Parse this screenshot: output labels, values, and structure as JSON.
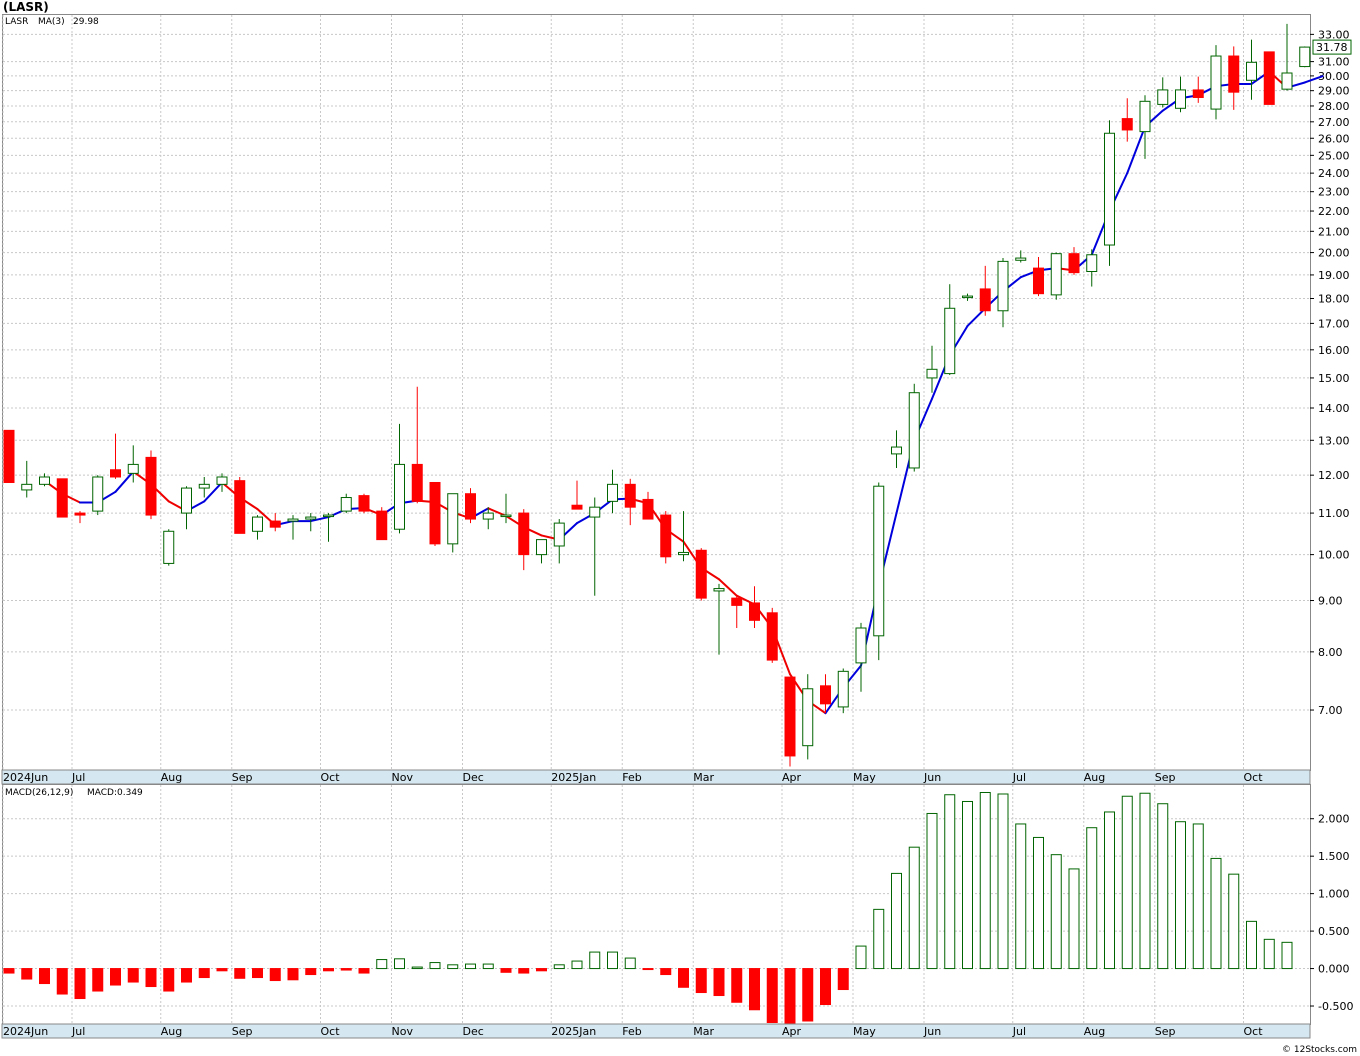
{
  "chart_data": {
    "type": "candlestick",
    "symbol_title": "(LASR)",
    "price_panel": {
      "legend": {
        "symbol": "LASR",
        "ma_label": "MA(3)",
        "ma_value": "29.98"
      },
      "last_price_label": "31.78",
      "y_scale": "log",
      "ylim": [
        6.1,
        34.5
      ],
      "y_ticks": [
        "7.00",
        "8.00",
        "9.00",
        "10.00",
        "11.00",
        "12.00",
        "13.00",
        "14.00",
        "15.00",
        "16.00",
        "17.00",
        "18.00",
        "19.00",
        "20.00",
        "21.00",
        "22.00",
        "23.00",
        "24.00",
        "25.00",
        "26.00",
        "27.00",
        "28.00",
        "29.00",
        "30.00",
        "31.00",
        "33.00"
      ],
      "candles": [
        {
          "o": 13.3,
          "h": 13.3,
          "l": 11.8,
          "c": 11.8
        },
        {
          "o": 11.6,
          "h": 12.4,
          "l": 11.4,
          "c": 11.75
        },
        {
          "o": 11.75,
          "h": 12.05,
          "l": 11.7,
          "c": 11.95
        },
        {
          "o": 11.9,
          "h": 11.9,
          "l": 10.9,
          "c": 10.9
        },
        {
          "o": 11.0,
          "h": 11.05,
          "l": 10.75,
          "c": 10.95
        },
        {
          "o": 11.05,
          "h": 12.0,
          "l": 10.95,
          "c": 11.95
        },
        {
          "o": 12.15,
          "h": 13.2,
          "l": 11.9,
          "c": 11.95
        },
        {
          "o": 12.05,
          "h": 12.85,
          "l": 11.8,
          "c": 12.3
        },
        {
          "o": 12.5,
          "h": 12.7,
          "l": 10.85,
          "c": 10.95
        },
        {
          "o": 9.8,
          "h": 10.6,
          "l": 9.75,
          "c": 10.55
        },
        {
          "o": 11.0,
          "h": 11.7,
          "l": 10.6,
          "c": 11.65
        },
        {
          "o": 11.65,
          "h": 11.95,
          "l": 11.4,
          "c": 11.75
        },
        {
          "o": 11.75,
          "h": 12.05,
          "l": 11.55,
          "c": 11.95
        },
        {
          "o": 11.85,
          "h": 11.95,
          "l": 10.5,
          "c": 10.5
        },
        {
          "o": 10.55,
          "h": 10.95,
          "l": 10.35,
          "c": 10.9
        },
        {
          "o": 10.8,
          "h": 11.0,
          "l": 10.55,
          "c": 10.65
        },
        {
          "o": 10.8,
          "h": 10.95,
          "l": 10.35,
          "c": 10.85
        },
        {
          "o": 10.85,
          "h": 11.0,
          "l": 10.55,
          "c": 10.9
        },
        {
          "o": 10.95,
          "h": 11.0,
          "l": 10.3,
          "c": 10.95
        },
        {
          "o": 11.05,
          "h": 11.5,
          "l": 11.0,
          "c": 11.4
        },
        {
          "o": 11.45,
          "h": 11.5,
          "l": 11.0,
          "c": 11.05
        },
        {
          "o": 11.05,
          "h": 11.15,
          "l": 10.35,
          "c": 10.35
        },
        {
          "o": 10.6,
          "h": 13.5,
          "l": 10.5,
          "c": 12.3
        },
        {
          "o": 12.3,
          "h": 14.7,
          "l": 11.25,
          "c": 11.3
        },
        {
          "o": 11.8,
          "h": 11.8,
          "l": 10.2,
          "c": 10.25
        },
        {
          "o": 10.25,
          "h": 11.5,
          "l": 10.05,
          "c": 11.5
        },
        {
          "o": 11.5,
          "h": 11.65,
          "l": 10.75,
          "c": 10.85
        },
        {
          "o": 10.85,
          "h": 11.15,
          "l": 10.6,
          "c": 11.0
        },
        {
          "o": 10.95,
          "h": 11.5,
          "l": 10.75,
          "c": 10.95
        },
        {
          "o": 11.0,
          "h": 11.1,
          "l": 9.65,
          "c": 10.0
        },
        {
          "o": 10.0,
          "h": 10.35,
          "l": 9.8,
          "c": 10.35
        },
        {
          "o": 10.2,
          "h": 10.85,
          "l": 9.8,
          "c": 10.75
        },
        {
          "o": 11.2,
          "h": 11.85,
          "l": 11.1,
          "c": 11.1
        },
        {
          "o": 10.9,
          "h": 11.4,
          "l": 9.1,
          "c": 11.15
        },
        {
          "o": 11.3,
          "h": 12.15,
          "l": 11.0,
          "c": 11.75
        },
        {
          "o": 11.75,
          "h": 11.9,
          "l": 10.7,
          "c": 11.15
        },
        {
          "o": 11.35,
          "h": 11.55,
          "l": 10.85,
          "c": 10.85
        },
        {
          "o": 10.95,
          "h": 11.05,
          "l": 9.8,
          "c": 9.95
        },
        {
          "o": 10.0,
          "h": 11.05,
          "l": 9.85,
          "c": 10.05
        },
        {
          "o": 10.1,
          "h": 10.15,
          "l": 9.0,
          "c": 9.05
        },
        {
          "o": 9.2,
          "h": 9.35,
          "l": 7.95,
          "c": 9.25
        },
        {
          "o": 9.05,
          "h": 9.1,
          "l": 8.45,
          "c": 8.9
        },
        {
          "o": 8.95,
          "h": 9.3,
          "l": 8.45,
          "c": 8.6
        },
        {
          "o": 8.75,
          "h": 8.85,
          "l": 7.8,
          "c": 7.85
        },
        {
          "o": 7.55,
          "h": 7.55,
          "l": 6.15,
          "c": 6.3
        },
        {
          "o": 6.45,
          "h": 7.6,
          "l": 6.25,
          "c": 7.35
        },
        {
          "o": 7.4,
          "h": 7.6,
          "l": 6.95,
          "c": 7.1
        },
        {
          "o": 7.05,
          "h": 7.7,
          "l": 6.95,
          "c": 7.65
        },
        {
          "o": 7.8,
          "h": 8.55,
          "l": 7.3,
          "c": 8.45
        },
        {
          "o": 8.3,
          "h": 11.8,
          "l": 7.85,
          "c": 11.7
        },
        {
          "o": 12.6,
          "h": 13.3,
          "l": 12.2,
          "c": 12.8
        },
        {
          "o": 12.2,
          "h": 14.8,
          "l": 12.1,
          "c": 14.5
        },
        {
          "o": 15.0,
          "h": 16.15,
          "l": 14.5,
          "c": 15.3
        },
        {
          "o": 15.15,
          "h": 18.6,
          "l": 15.1,
          "c": 17.6
        },
        {
          "o": 18.1,
          "h": 18.2,
          "l": 17.9,
          "c": 18.1
        },
        {
          "o": 18.4,
          "h": 19.4,
          "l": 17.3,
          "c": 17.5
        },
        {
          "o": 17.5,
          "h": 19.75,
          "l": 16.85,
          "c": 19.6
        },
        {
          "o": 19.65,
          "h": 20.1,
          "l": 19.55,
          "c": 19.75
        },
        {
          "o": 19.3,
          "h": 19.8,
          "l": 18.1,
          "c": 18.2
        },
        {
          "o": 18.15,
          "h": 20.0,
          "l": 17.95,
          "c": 19.95
        },
        {
          "o": 19.95,
          "h": 20.25,
          "l": 19.0,
          "c": 19.1
        },
        {
          "o": 19.15,
          "h": 20.15,
          "l": 18.5,
          "c": 19.9
        },
        {
          "o": 20.35,
          "h": 27.1,
          "l": 19.4,
          "c": 26.3
        },
        {
          "o": 27.2,
          "h": 28.5,
          "l": 25.8,
          "c": 26.5
        },
        {
          "o": 26.4,
          "h": 28.7,
          "l": 24.8,
          "c": 28.3
        },
        {
          "o": 28.1,
          "h": 29.9,
          "l": 27.9,
          "c": 29.05
        },
        {
          "o": 27.85,
          "h": 29.95,
          "l": 27.6,
          "c": 29.05
        },
        {
          "o": 29.05,
          "h": 29.95,
          "l": 28.2,
          "c": 28.55
        },
        {
          "o": 27.8,
          "h": 32.2,
          "l": 27.15,
          "c": 31.4
        },
        {
          "o": 31.4,
          "h": 32.1,
          "l": 27.75,
          "c": 28.9
        },
        {
          "o": 29.7,
          "h": 32.6,
          "l": 28.4,
          "c": 30.95
        },
        {
          "o": 31.7,
          "h": 31.7,
          "l": 28.1,
          "c": 28.1
        },
        {
          "o": 29.1,
          "h": 33.8,
          "l": 29.0,
          "c": 30.2
        },
        {
          "o": 30.65,
          "h": 32.1,
          "l": 30.6,
          "c": 32.05
        }
      ],
      "ma_line": [
        {
          "i": 2,
          "v": 11.85,
          "trend": "down"
        },
        {
          "i": 3,
          "v": 11.5,
          "trend": "down"
        },
        {
          "i": 4,
          "v": 11.27,
          "trend": "down"
        },
        {
          "i": 5,
          "v": 11.27,
          "trend": "up"
        },
        {
          "i": 6,
          "v": 11.55,
          "trend": "up"
        },
        {
          "i": 7,
          "v": 12.1,
          "trend": "up"
        },
        {
          "i": 8,
          "v": 11.75,
          "trend": "down"
        },
        {
          "i": 9,
          "v": 11.3,
          "trend": "down"
        },
        {
          "i": 10,
          "v": 11.05,
          "trend": "down"
        },
        {
          "i": 11,
          "v": 11.3,
          "trend": "up"
        },
        {
          "i": 12,
          "v": 11.8,
          "trend": "up"
        },
        {
          "i": 13,
          "v": 11.4,
          "trend": "down"
        },
        {
          "i": 14,
          "v": 11.1,
          "trend": "down"
        },
        {
          "i": 15,
          "v": 10.7,
          "trend": "down"
        },
        {
          "i": 16,
          "v": 10.8,
          "trend": "up"
        },
        {
          "i": 17,
          "v": 10.8,
          "trend": "up"
        },
        {
          "i": 18,
          "v": 10.9,
          "trend": "up"
        },
        {
          "i": 19,
          "v": 11.1,
          "trend": "up"
        },
        {
          "i": 20,
          "v": 11.13,
          "trend": "up"
        },
        {
          "i": 21,
          "v": 10.95,
          "trend": "down"
        },
        {
          "i": 22,
          "v": 11.25,
          "trend": "up"
        },
        {
          "i": 23,
          "v": 11.32,
          "trend": "up"
        },
        {
          "i": 24,
          "v": 11.28,
          "trend": "down"
        },
        {
          "i": 25,
          "v": 11.02,
          "trend": "down"
        },
        {
          "i": 26,
          "v": 10.87,
          "trend": "down"
        },
        {
          "i": 27,
          "v": 11.12,
          "trend": "up"
        },
        {
          "i": 28,
          "v": 10.93,
          "trend": "down"
        },
        {
          "i": 29,
          "v": 10.65,
          "trend": "down"
        },
        {
          "i": 30,
          "v": 10.45,
          "trend": "down"
        },
        {
          "i": 31,
          "v": 10.35,
          "trend": "down"
        },
        {
          "i": 32,
          "v": 10.75,
          "trend": "up"
        },
        {
          "i": 33,
          "v": 11.0,
          "trend": "up"
        },
        {
          "i": 34,
          "v": 11.35,
          "trend": "up"
        },
        {
          "i": 35,
          "v": 11.37,
          "trend": "up"
        },
        {
          "i": 36,
          "v": 11.25,
          "trend": "down"
        },
        {
          "i": 37,
          "v": 10.6,
          "trend": "down"
        },
        {
          "i": 38,
          "v": 10.3,
          "trend": "down"
        },
        {
          "i": 39,
          "v": 9.7,
          "trend": "down"
        },
        {
          "i": 40,
          "v": 9.45,
          "trend": "down"
        },
        {
          "i": 41,
          "v": 9.1,
          "trend": "down"
        },
        {
          "i": 42,
          "v": 8.92,
          "trend": "down"
        },
        {
          "i": 43,
          "v": 8.45,
          "trend": "down"
        },
        {
          "i": 44,
          "v": 7.6,
          "trend": "down"
        },
        {
          "i": 45,
          "v": 7.15,
          "trend": "down"
        },
        {
          "i": 46,
          "v": 6.95,
          "trend": "down"
        },
        {
          "i": 47,
          "v": 7.37,
          "trend": "up"
        },
        {
          "i": 48,
          "v": 7.75,
          "trend": "up"
        },
        {
          "i": 49,
          "v": 9.3,
          "trend": "up"
        },
        {
          "i": 50,
          "v": 11.0,
          "trend": "up"
        },
        {
          "i": 51,
          "v": 13.0,
          "trend": "up"
        },
        {
          "i": 52,
          "v": 14.3,
          "trend": "up"
        },
        {
          "i": 53,
          "v": 15.8,
          "trend": "up"
        },
        {
          "i": 54,
          "v": 16.9,
          "trend": "up"
        },
        {
          "i": 55,
          "v": 17.6,
          "trend": "up"
        },
        {
          "i": 56,
          "v": 18.3,
          "trend": "up"
        },
        {
          "i": 57,
          "v": 18.9,
          "trend": "up"
        },
        {
          "i": 58,
          "v": 19.2,
          "trend": "up"
        },
        {
          "i": 59,
          "v": 19.3,
          "trend": "up"
        },
        {
          "i": 60,
          "v": 19.2,
          "trend": "down"
        },
        {
          "i": 61,
          "v": 19.9,
          "trend": "up"
        },
        {
          "i": 62,
          "v": 22.0,
          "trend": "up"
        },
        {
          "i": 63,
          "v": 24.0,
          "trend": "up"
        },
        {
          "i": 64,
          "v": 26.7,
          "trend": "up"
        },
        {
          "i": 65,
          "v": 27.7,
          "trend": "up"
        },
        {
          "i": 66,
          "v": 28.5,
          "trend": "up"
        },
        {
          "i": 67,
          "v": 28.7,
          "trend": "up"
        },
        {
          "i": 68,
          "v": 29.3,
          "trend": "up"
        },
        {
          "i": 69,
          "v": 29.45,
          "trend": "up"
        },
        {
          "i": 70,
          "v": 29.45,
          "trend": "up"
        },
        {
          "i": 71,
          "v": 30.3,
          "trend": "up"
        },
        {
          "i": 72,
          "v": 29.2,
          "trend": "down"
        },
        {
          "i": 73,
          "v": 29.55,
          "trend": "up"
        },
        {
          "i": 74,
          "v": 29.98,
          "trend": "up"
        }
      ]
    },
    "macd_panel": {
      "legend": {
        "params": "MACD(26,12,9)",
        "value_label": "MACD:0.349"
      },
      "ylim": [
        -0.74,
        2.45
      ],
      "y_ticks": [
        "-0.500",
        "0.000",
        "0.500",
        "1.000",
        "1.500",
        "2.000"
      ],
      "values": [
        -0.06,
        -0.14,
        -0.2,
        -0.34,
        -0.4,
        -0.3,
        -0.22,
        -0.18,
        -0.24,
        -0.3,
        -0.18,
        -0.12,
        -0.03,
        -0.13,
        -0.12,
        -0.16,
        -0.15,
        -0.08,
        -0.03,
        -0.02,
        -0.06,
        0.12,
        0.13,
        0.02,
        0.08,
        0.05,
        0.06,
        0.06,
        -0.05,
        -0.06,
        -0.03,
        0.05,
        0.1,
        0.22,
        0.22,
        0.14,
        -0.01,
        -0.08,
        -0.25,
        -0.32,
        -0.36,
        -0.45,
        -0.55,
        -0.72,
        -0.74,
        -0.7,
        -0.48,
        -0.28,
        0.3,
        0.79,
        1.27,
        1.62,
        2.07,
        2.32,
        2.23,
        2.35,
        2.33,
        1.93,
        1.75,
        1.52,
        1.33,
        1.88,
        2.09,
        2.3,
        2.34,
        2.2,
        1.96,
        1.93,
        1.47,
        1.26,
        0.63,
        0.39,
        0.35
      ]
    },
    "x_axis": {
      "labels": [
        {
          "text": "2024Jun",
          "i": 0
        },
        {
          "text": "Jul",
          "i": 4
        },
        {
          "text": "Aug",
          "i": 9
        },
        {
          "text": "Sep",
          "i": 13
        },
        {
          "text": "Oct",
          "i": 18
        },
        {
          "text": "Nov",
          "i": 22
        },
        {
          "text": "Dec",
          "i": 26
        },
        {
          "text": "2025Jan",
          "i": 31
        },
        {
          "text": "Feb",
          "i": 35
        },
        {
          "text": "Mar",
          "i": 39
        },
        {
          "text": "Apr",
          "i": 44
        },
        {
          "text": "May",
          "i": 48
        },
        {
          "text": "Jun",
          "i": 52
        },
        {
          "text": "Jul",
          "i": 57
        },
        {
          "text": "Aug",
          "i": 61
        },
        {
          "text": "Sep",
          "i": 65
        },
        {
          "text": "Oct",
          "i": 70
        }
      ]
    },
    "colors": {
      "up_candle": "#006400",
      "down_candle": "#ff0000",
      "ma_up": "#0000dd",
      "ma_down": "#ee0000",
      "grid": "#c8c8c8",
      "axis_band": "#d5e7f0"
    },
    "grid": true
  },
  "footer": {
    "copyright": "© 12Stocks.com"
  }
}
